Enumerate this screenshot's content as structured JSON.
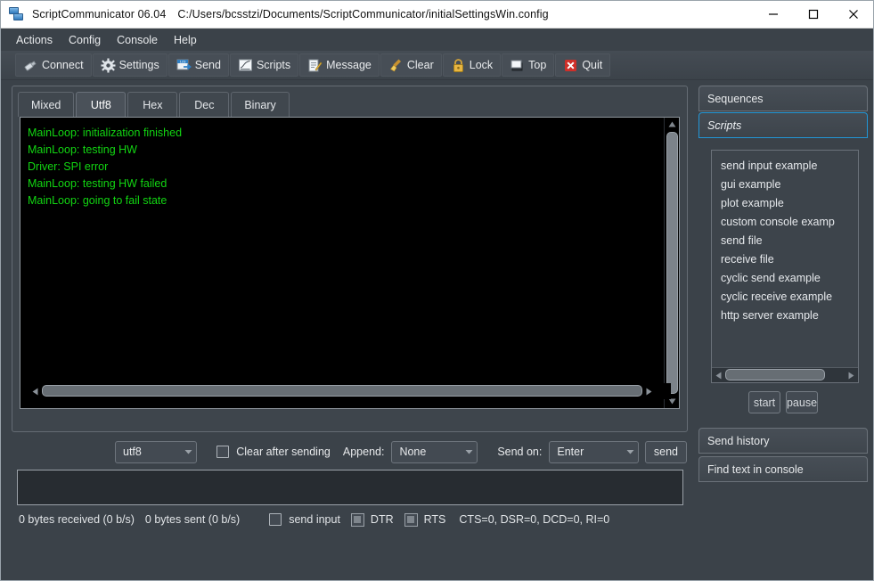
{
  "window": {
    "app_name": "ScriptCommunicator 06.04",
    "file_path": "C:/Users/bcsstzi/Documents/ScriptCommunicator/initialSettingsWin.config",
    "minimize_label": "minimize",
    "maximize_label": "maximize",
    "close_label": "close"
  },
  "menubar": {
    "items": [
      {
        "label": "Actions"
      },
      {
        "label": "Config"
      },
      {
        "label": "Console"
      },
      {
        "label": "Help"
      }
    ]
  },
  "toolbar": {
    "buttons": [
      {
        "label": "Connect",
        "icon": "plug-icon"
      },
      {
        "label": "Settings",
        "icon": "gear-icon"
      },
      {
        "label": "Send",
        "icon": "send-numbers-icon"
      },
      {
        "label": "Scripts",
        "icon": "script-chart-icon"
      },
      {
        "label": "Message",
        "icon": "notepad-pencil-icon"
      },
      {
        "label": "Clear",
        "icon": "broom-icon"
      },
      {
        "label": "Lock",
        "icon": "padlock-icon"
      },
      {
        "label": "Top",
        "icon": "window-top-icon"
      },
      {
        "label": "Quit",
        "icon": "red-x-icon"
      }
    ]
  },
  "console": {
    "tabs": [
      {
        "label": "Mixed",
        "active": false
      },
      {
        "label": "Utf8",
        "active": true
      },
      {
        "label": "Hex",
        "active": false
      },
      {
        "label": "Dec",
        "active": false
      },
      {
        "label": "Binary",
        "active": false
      }
    ],
    "text_color": "#12d612",
    "background": "#000000",
    "lines": [
      "MainLoop: initialization finished",
      "MainLoop: testing HW",
      "Driver: SPI error",
      "MainLoop: testing HW failed",
      "MainLoop: going to fail state"
    ]
  },
  "send_controls": {
    "encoding_value": "utf8",
    "clear_after_sending_label": "Clear after sending",
    "clear_after_sending_checked": false,
    "append_label": "Append:",
    "append_value": "None",
    "send_on_label": "Send on:",
    "send_on_value": "Enter",
    "send_button_label": "send",
    "send_input_value": ""
  },
  "statusbar": {
    "bytes_received": "0 bytes received (0 b/s)",
    "bytes_sent": "0 bytes sent (0 b/s)",
    "send_input_label": "send input",
    "send_input_checked": false,
    "dtr_label": "DTR",
    "rts_label": "RTS",
    "signals": "CTS=0, DSR=0, DCD=0, RI=0"
  },
  "sidebar": {
    "sequences_label": "Sequences",
    "scripts_label": "Scripts",
    "scripts": [
      {
        "label": "send input example"
      },
      {
        "label": "gui example"
      },
      {
        "label": "plot example"
      },
      {
        "label": "custom console examp"
      },
      {
        "label": "send file"
      },
      {
        "label": "receive file"
      },
      {
        "label": "cyclic send example"
      },
      {
        "label": "cyclic receive example"
      },
      {
        "label": "http server example"
      }
    ],
    "start_label": "start",
    "pause_label": "pause",
    "send_history_label": "Send history",
    "find_text_label": "Find text in console"
  },
  "theme": {
    "accent": "#2196d6",
    "window_bg": "#3b4249",
    "panel_bg": "#3d444b"
  }
}
